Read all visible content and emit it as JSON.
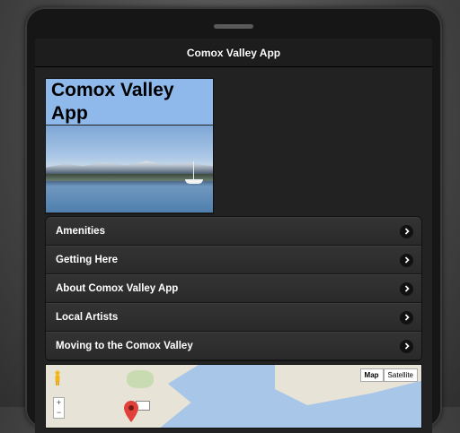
{
  "header": {
    "title": "Comox Valley App"
  },
  "banner": {
    "title": "Comox Valley App"
  },
  "menu": {
    "items": [
      {
        "label": "Amenities"
      },
      {
        "label": "Getting Here"
      },
      {
        "label": "About Comox Valley App"
      },
      {
        "label": "Local Artists"
      },
      {
        "label": "Moving to the Comox Valley"
      }
    ]
  },
  "map": {
    "map_label": "Map",
    "satellite_label": "Satellite",
    "zoom_in": "+",
    "zoom_out": "−"
  },
  "colors": {
    "header_bg": "#1d1d1d",
    "list_bg": "#2c2c2c",
    "banner_sky": "#8fb9ea"
  }
}
